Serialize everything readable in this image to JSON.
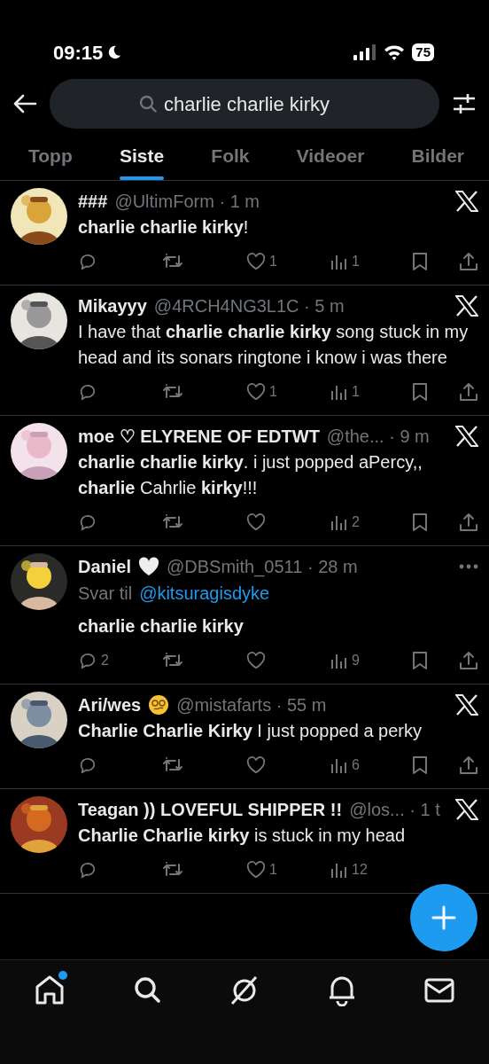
{
  "status_bar": {
    "time": "09:15",
    "battery": "75"
  },
  "search": {
    "value": "charlie charlie kirky"
  },
  "tabs": [
    {
      "label": "Topp",
      "selected": false
    },
    {
      "label": "Siste",
      "selected": true
    },
    {
      "label": "Folk",
      "selected": false
    },
    {
      "label": "Videoer",
      "selected": false
    },
    {
      "label": "Bilder",
      "selected": false
    }
  ],
  "posts": [
    {
      "name": "###",
      "meta": "@UltimForm · 1 m",
      "corner": {
        "kind": "x-logo"
      },
      "text": "**charlie charlie kirky**!",
      "likes": "1",
      "views": "1",
      "save_share_visible": true
    },
    {
      "name": "Mikayyy",
      "meta": "@4RCH4NG3L1C · 5 m",
      "corner": {
        "kind": "x-logo"
      },
      "text": "I have that **charlie charlie kirky** song stuck in my head and its sonars ringtone i know i was there",
      "likes": "1",
      "views": "1",
      "save_share_visible": true
    },
    {
      "name": "moe ♡ ELYRENE OF EDTWT",
      "meta": "@the... · 9 m",
      "corner": {
        "kind": "x-logo"
      },
      "text": "**charlie charlie kirky**. i just popped aPercy,, **charlie** Cahrlie **kirky**!!!",
      "views": "2",
      "save_share_visible": true
    },
    {
      "name": "Daniel",
      "badge": {
        "kind": "heart"
      },
      "meta": "@DBSmith_0511 · 28 m",
      "corner": {
        "kind": "more"
      },
      "reply_to": {
        "prefix": "Svar til",
        "handle": "@kitsuragisdyke"
      },
      "text": "**charlie charlie kirky**",
      "replies": "2",
      "views": "9",
      "save_share_visible": true
    },
    {
      "name": "Ari/wes",
      "badge": {
        "kind": "dizzy"
      },
      "meta": "@mistafarts · 55 m",
      "corner": {
        "kind": "x-logo"
      },
      "text": "**Charlie Charlie Kirky** I just popped a perky",
      "views": "6",
      "save_share_visible": true
    },
    {
      "name": "Teagan )) LOVEFUL SHIPPER !!",
      "meta": "@los... · 1 t",
      "corner": {
        "kind": "x-logo"
      },
      "text": "**Charlie Charlie kirky** is stuck in my head",
      "likes": "1",
      "views": "12",
      "save_share_visible": false
    }
  ],
  "bottom_nav": [
    {
      "kind": "home",
      "unread": true
    },
    {
      "kind": "search",
      "unread": false
    },
    {
      "kind": "grok",
      "unread": false
    },
    {
      "kind": "bell",
      "unread": false
    },
    {
      "kind": "mail",
      "unread": false
    }
  ]
}
